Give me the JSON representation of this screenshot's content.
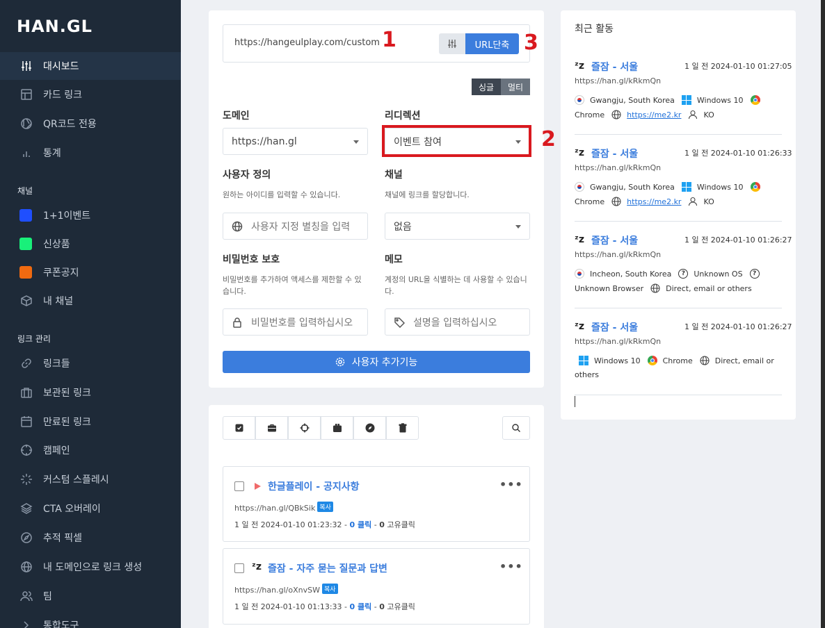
{
  "brand": {
    "logo": "HAN.GL"
  },
  "sidebar": {
    "nav": [
      {
        "label": "대시보드",
        "icon": "sliders-icon"
      },
      {
        "label": "카드 링크",
        "icon": "layout-icon"
      },
      {
        "label": "QR코드 전용",
        "icon": "aperture-icon"
      },
      {
        "label": "통계",
        "icon": "bar-chart-icon"
      }
    ],
    "channels_label": "채널",
    "channels": [
      {
        "label": "1+1이벤트",
        "color": "#1f4fff"
      },
      {
        "label": "신상품",
        "color": "#19f07a"
      },
      {
        "label": "쿠폰공지",
        "color": "#f06a10"
      },
      {
        "label": "내 채널",
        "icon": "box-icon"
      }
    ],
    "links_label": "링크 관리",
    "links": [
      {
        "label": "링크들",
        "icon": "link-icon"
      },
      {
        "label": "보관된 링크",
        "icon": "briefcase-icon"
      },
      {
        "label": "만료된 링크",
        "icon": "calendar-icon"
      },
      {
        "label": "캠페인",
        "icon": "crosshair-icon"
      },
      {
        "label": "커스텀 스플레시",
        "icon": "loader-icon"
      },
      {
        "label": "CTA 오버레이",
        "icon": "layers-icon"
      },
      {
        "label": "추적 픽셀",
        "icon": "compass-icon"
      },
      {
        "label": "내 도메인으로 링크 생성",
        "icon": "globe-icon"
      },
      {
        "label": "팀",
        "icon": "users-icon"
      },
      {
        "label": "통합도구",
        "icon": "chevron-right-icon"
      }
    ]
  },
  "shortener": {
    "url_value": "https://hangeulplay.com/custom",
    "shorten_label": "URL단축",
    "mode_single": "싱글",
    "mode_multi": "멀티",
    "domain_label": "도메인",
    "domain_value": "https://han.gl",
    "redirect_label": "리디렉션",
    "redirect_value": "이벤트 참여",
    "custom_label": "사용자 정의",
    "custom_hint": "원하는 아이디를 입력할 수 있습니다.",
    "custom_placeholder": "사용자 지정 별칭을 입력",
    "channel_label": "채널",
    "channel_hint": "채널에 링크를 할당합니다.",
    "channel_value": "없음",
    "password_label": "비밀번호 보호",
    "password_hint": "비밀번호를 추가하여 액세스를 제한할 수 있습니다.",
    "password_placeholder": "비밀번호를 입력하십시오",
    "memo_label": "메모",
    "memo_hint": "계정의 URL을 식별하는 데 사용할 수 있습니다.",
    "memo_placeholder": "설명을 입력하십시오",
    "more_button": "사용자 추가기능"
  },
  "annotations": {
    "one": "1",
    "two": "2",
    "three": "3"
  },
  "links": [
    {
      "title": "한글플레이 - 공지사항",
      "url": "https://han.gl/QBkSik",
      "copy": "복사",
      "time": "1 일 전 2024-01-10 01:23:32",
      "clicks": "0 클릭",
      "unique": "0",
      "unique_label": "고유클릭",
      "icon": "play-icon"
    },
    {
      "title": "즐잠 - 자주 묻는 질문과 답변",
      "url": "https://han.gl/oXnvSW",
      "copy": "복사",
      "time": "1 일 전 2024-01-10 01:13:33",
      "clicks": "0 클릭",
      "unique": "0",
      "unique_label": "고유클릭",
      "icon": "zz-icon"
    }
  ],
  "activity": {
    "title": "최근 활동",
    "items": [
      {
        "name": "즐잠 - 서울",
        "time": "1 일 전 2024-01-10 01:27:05",
        "url": "https://han.gl/kRkmQn",
        "location": "Gwangju, South Korea",
        "os": "Windows 10",
        "browser": "Chrome",
        "referer": "https://me2.kr",
        "lang": "KO"
      },
      {
        "name": "즐잠 - 서울",
        "time": "1 일 전 2024-01-10 01:26:33",
        "url": "https://han.gl/kRkmQn",
        "location": "Gwangju, South Korea",
        "os": "Windows 10",
        "browser": "Chrome",
        "referer": "https://me2.kr",
        "lang": "KO"
      },
      {
        "name": "즐잠 - 서울",
        "time": "1 일 전 2024-01-10 01:26:27",
        "url": "https://han.gl/kRkmQn",
        "location": "Incheon, South Korea",
        "os": "Unknown OS",
        "browser": "Unknown Browser",
        "referer": "Direct, email or others"
      },
      {
        "name": "즐잠 - 서울",
        "time": "1 일 전 2024-01-10 01:26:27",
        "url": "https://han.gl/kRkmQn",
        "os": "Windows 10",
        "browser": "Chrome",
        "referer_a": "Direct, email or",
        "referer_b": "others"
      }
    ]
  }
}
